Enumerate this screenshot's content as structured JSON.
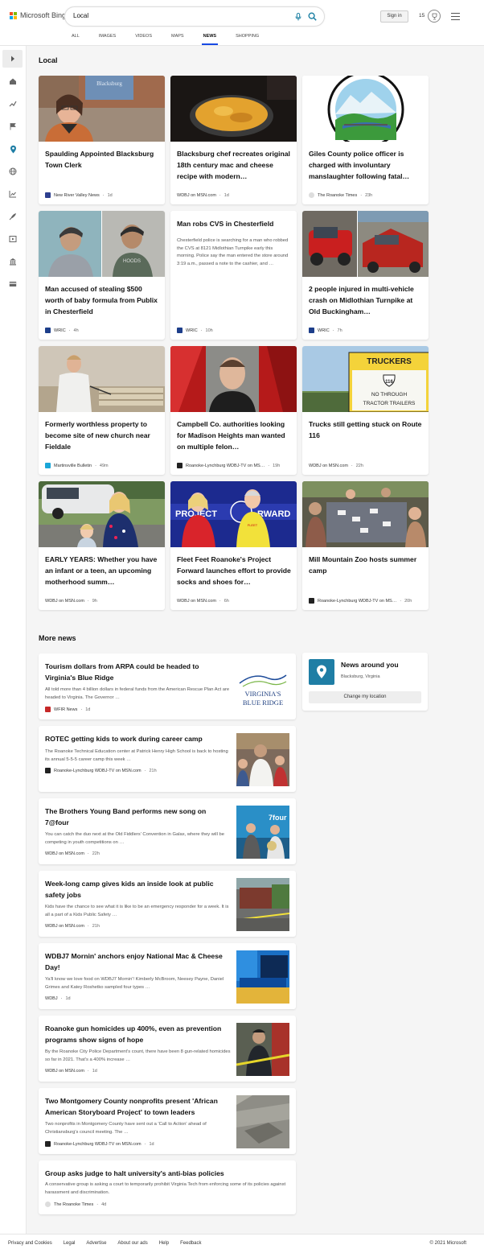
{
  "header": {
    "logo_text": "Microsoft Bing",
    "query": "Local",
    "signin_label": "Sign in",
    "points": "15",
    "tabs": [
      "ALL",
      "IMAGES",
      "VIDEOS",
      "MAPS",
      "NEWS",
      "SHOPPING"
    ],
    "active_tab": "NEWS"
  },
  "local": {
    "title": "Local",
    "cards": [
      {
        "title": "Spaulding Appointed Blacksburg Town Clerk",
        "source": "New River Valley News",
        "age": "1d",
        "favicon_color": "#2d3f8f",
        "image": "woman-portrait"
      },
      {
        "title": "Blacksburg chef recreates original 18th century mac and cheese recipe with modern…",
        "source": "WDBJ on MSN.com",
        "age": "1d",
        "favicon_color": "",
        "image": "mac-and-cheese"
      },
      {
        "title": "Giles County police officer is charged with involuntary manslaughter following fatal…",
        "source": "The Roanoke Times",
        "age": "23h",
        "favicon_color": "#dddddd",
        "image": "county-seal"
      },
      {
        "title": "Man accused of stealing $500 worth of baby formula from Publix in Chesterfield",
        "source": "WRIC",
        "age": "4h",
        "favicon_color": "#1d3e8a",
        "image": "surveillance-stills"
      },
      {
        "title": "Man robs CVS in Chesterfield",
        "snippet": "Chesterfield police is searching for a man who robbed the CVS at 8121 Midlothian Turnpike early this morning. Police say the man entered the store around 3:19 a.m., passed a note to the cashier, and …",
        "source": "WRIC",
        "age": "10h",
        "favicon_color": "#1d3e8a",
        "image": ""
      },
      {
        "title": "2 people injured in multi-vehicle crash on Midlothian Turnpike at Old Buckingham…",
        "source": "WRIC",
        "age": "7h",
        "favicon_color": "#1d3e8a",
        "image": "car-crash"
      },
      {
        "title": "Formerly worthless property to become site of new church near Fieldale",
        "source": "Martinsville Bulletin",
        "age": "49m",
        "favicon_color": "#1aa6d8",
        "image": "meeting-room"
      },
      {
        "title": "Campbell Co. authorities looking for Madison Heights man wanted on multiple felon…",
        "source": "Roanoke-Lynchburg WDBJ-TV on MS…",
        "age": "19h",
        "favicon_color": "#222222",
        "image": "mugshot"
      },
      {
        "title": "Trucks still getting stuck on Route 116",
        "source": "WDBJ on MSN.com",
        "age": "22h",
        "favicon_color": "",
        "image": "road-sign"
      },
      {
        "title": "EARLY YEARS: Whether you have an infant or a teen, an upcoming motherhood summ…",
        "source": "WDBJ on MSN.com",
        "age": "9h",
        "favicon_color": "",
        "image": "mother-daughter"
      },
      {
        "title": "Fleet Feet Roanoke's Project Forward launches effort to provide socks and shoes for…",
        "source": "WDBJ on MSN.com",
        "age": "6h",
        "favicon_color": "",
        "image": "project-forward"
      },
      {
        "title": "Mill Mountain Zoo hosts summer camp",
        "source": "Roanoke-Lynchburg WDBJ-TV on MS…",
        "age": "20h",
        "favicon_color": "#222222",
        "image": "kids-camp"
      }
    ]
  },
  "more_news": {
    "title": "More news",
    "items": [
      {
        "title": "Tourism dollars from ARPA could be headed to Virginia's Blue Ridge",
        "snippet": "All told more than 4 billion dollars in federal funds from the American Rescue Plan Act are headed to Virginia. The Governor …",
        "source": "WFIR News",
        "age": "1d",
        "favicon_color": "#c62828",
        "image": "blue-ridge-logo",
        "image_text_1": "VIRGINIA'S",
        "image_text_2": "BLUE RIDGE"
      },
      {
        "title": "ROTEC getting kids to work during career camp",
        "snippet": "The Roanoke Technical Education center at Patrick Henry High School is back to hosting its annual 5-5-5 career camp this week …",
        "source": "Roanoke-Lynchburg WDBJ-TV on MSN.com",
        "age": "21h",
        "favicon_color": "#222222",
        "image": "career-camp"
      },
      {
        "title": "The Brothers Young Band performs new song on 7@four",
        "snippet": "You can catch the duo next at the Old Fiddlers' Convention in Galax, where they will be competing in youth competitions on …",
        "source": "WDBJ on MSN.com",
        "age": "22h",
        "favicon_color": "",
        "image": "band-studio"
      },
      {
        "title": "Week-long camp gives kids an inside look at public safety jobs",
        "snippet": "Kids have the chance to see what it is like to be an emergency responder for a week. It is all a part of a Kids Public Safety …",
        "source": "WDBJ on MSN.com",
        "age": "21h",
        "favicon_color": "",
        "image": "safety-camp"
      },
      {
        "title": "WDBJ7 Mornin' anchors enjoy National Mac & Cheese Day!",
        "snippet": "Ya'll know we love food on WDBJ7 Mornin'! Kimberly McBroom, Neesey Payne, Daniel Grimes and Katey Roshetko sampled four types …",
        "source": "WDBJ",
        "age": "1d",
        "favicon_color": "",
        "image": "news-set"
      },
      {
        "title": "Roanoke gun homicides up 400%, even as prevention programs show signs of hope",
        "snippet": "By the Roanoke City Police Department's count, there have been 8 gun-related homicides so far in 2021. That's a 400% increase …",
        "source": "WDBJ on MSN.com",
        "age": "1d",
        "favicon_color": "",
        "image": "police-scene"
      },
      {
        "title": "Two Montgomery County nonprofits present 'African American Storyboard Project' to town leaders",
        "snippet": "Two nonprofits in Montgomery County have sent out a 'Call to Action' ahead of Christiansburg's council meeting. The …",
        "source": "Roanoke-Lynchburg WDBJ-TV on MSN.com",
        "age": "1d",
        "favicon_color": "#222222",
        "image": "storyboard"
      },
      {
        "title": "Group asks judge to halt university's anti-bias policies",
        "snippet": "A conservative group is asking a court to temporarily prohibit Virginia Tech from enforcing some of its policies against harassment and discrimination.",
        "source": "The Roanoke Times",
        "age": "4d",
        "favicon_color": "#dddddd",
        "image": ""
      }
    ]
  },
  "news_around": {
    "title": "News around you",
    "location": "Blacksburg, Virginia",
    "button": "Change my location"
  },
  "footer": {
    "links": [
      "Privacy and Cookies",
      "Legal",
      "Advertise",
      "About our ads",
      "Help",
      "Feedback"
    ],
    "copyright": "© 2021 Microsoft"
  },
  "colors": {
    "accent": "#174ae4",
    "location_pin": "#1f7ea5",
    "search_icon": "#1b7fa3"
  }
}
